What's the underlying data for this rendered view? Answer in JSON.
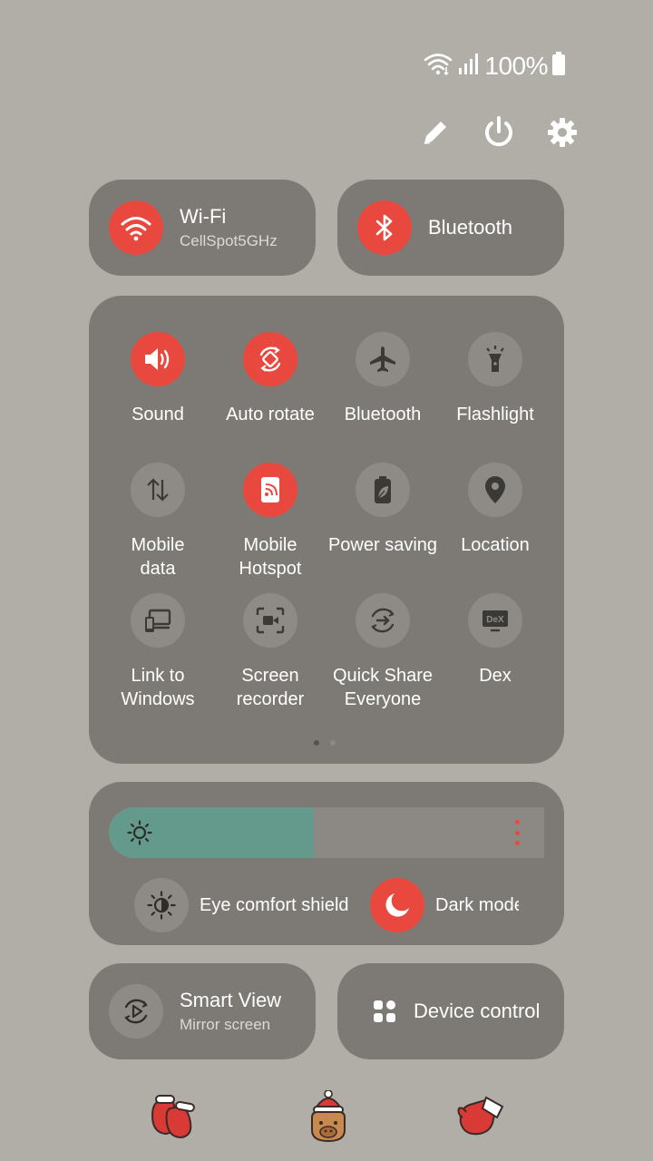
{
  "status_bar": {
    "battery_percent": "100%"
  },
  "top_actions": [
    "edit-icon",
    "power-icon",
    "settings-icon"
  ],
  "big_tiles": {
    "wifi": {
      "title": "Wi-Fi",
      "subtitle": "CellSpot5GHz",
      "active": true
    },
    "bluetooth": {
      "title": "Bluetooth",
      "active": true
    },
    "smart_view": {
      "title": "Smart View",
      "subtitle": "Mirror screen",
      "active": false
    },
    "device_control": {
      "title": "Device control"
    }
  },
  "quick_settings": [
    {
      "label": "Sound",
      "icon": "speaker-icon",
      "active": true
    },
    {
      "label": "Auto rotate",
      "icon": "rotate-icon",
      "active": true
    },
    {
      "label": "Bluetooth",
      "icon": "airplane-icon",
      "active": false
    },
    {
      "label": "Flashlight",
      "icon": "flashlight-icon",
      "active": false
    },
    {
      "label": "Mobile\ndata",
      "icon": "data-arrows-icon",
      "active": false
    },
    {
      "label": "Mobile\nHotspot",
      "icon": "hotspot-icon",
      "active": true
    },
    {
      "label": "Power saving",
      "icon": "battery-leaf-icon",
      "active": false
    },
    {
      "label": "Location",
      "icon": "location-pin-icon",
      "active": false
    },
    {
      "label": "Link to\nWindows",
      "icon": "link-windows-icon",
      "active": false
    },
    {
      "label": "Screen\nrecorder",
      "icon": "screen-recorder-icon",
      "active": false
    },
    {
      "label": "Quick Share\nEveryone",
      "icon": "quick-share-icon",
      "active": false
    },
    {
      "label": "Dex",
      "icon": "dex-icon",
      "active": false
    }
  ],
  "pagination": {
    "current": 1,
    "total": 2
  },
  "brightness": {
    "level": 0.47
  },
  "eye_comfort": {
    "label": "Eye comfort shield",
    "active": false
  },
  "dark_mode": {
    "label": "Dark mode",
    "active": true
  },
  "colors": {
    "accent": "#e9483f",
    "panel": "#7d7a75",
    "background": "#b1aea8",
    "brightness_fill": "#649a8b"
  },
  "stickers": [
    "mitten-pair-icon",
    "capybara-santa-icon",
    "mitten-icon"
  ]
}
